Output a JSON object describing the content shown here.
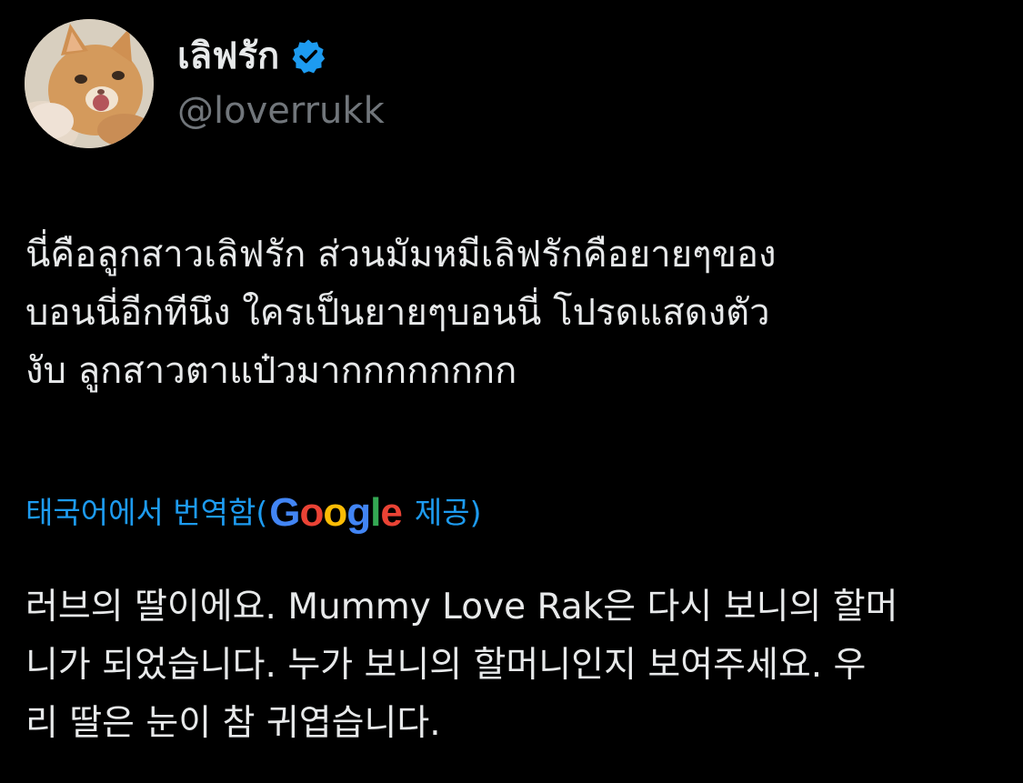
{
  "author": {
    "display_name": "เลิฟรัก",
    "handle": "@loverrukk",
    "verified": true,
    "avatar": "cat-photo"
  },
  "tweet": {
    "text_lines": [
      "นี่คือลูกสาวเลิฟรัก ส่วนมัมหมีเลิฟรักคือยายๆของ",
      "บอนนี่อีกทีนึง ใครเป็นยายๆบอนนี่ โปรดแสดงตัว",
      "งับ ลูกสาวตาแป๋วมากกกกกกกก"
    ]
  },
  "translation": {
    "prefix": "태국어에서 번역함(",
    "provider_letters": [
      "G",
      "o",
      "o",
      "g",
      "l",
      "e"
    ],
    "suffix": "제공)",
    "lines": [
      "러브의 딸이에요. Mummy Love Rak은 다시 보니의 할머",
      "니가 되었습니다. 누가 보니의 할머니인지 보여주세요. 우",
      "리 딸은 눈이 참 귀엽습니다."
    ]
  },
  "colors": {
    "background": "#000000",
    "text": "#e7e9ea",
    "secondary_text": "#71767b",
    "link": "#1d9bf0",
    "verified_badge": "#1d9bf0",
    "google_blue": "#4285F4",
    "google_red": "#EA4335",
    "google_yellow": "#FBBC05",
    "google_green": "#34A853"
  }
}
